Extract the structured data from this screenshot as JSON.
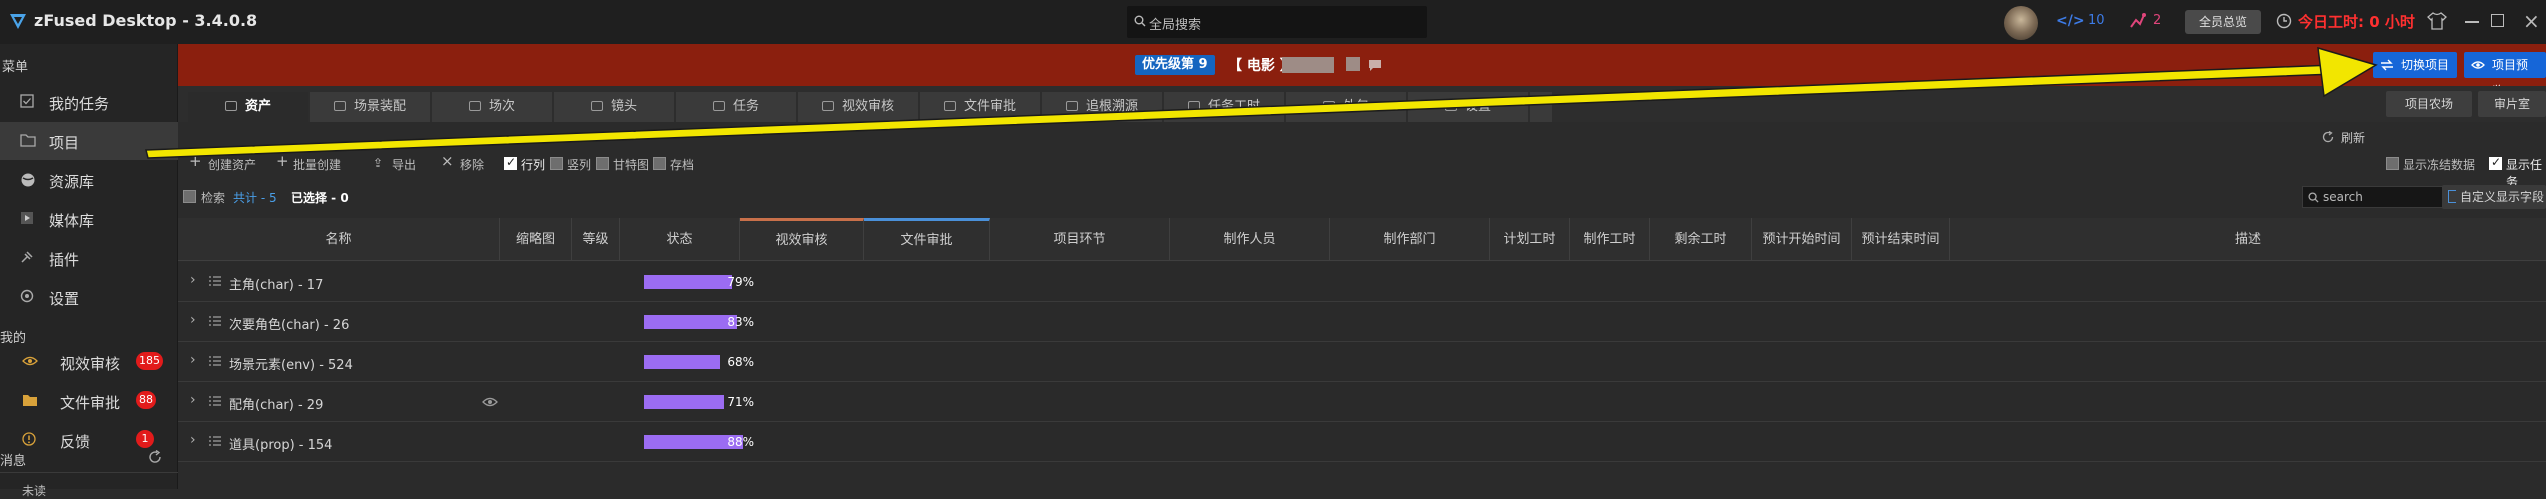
{
  "titlebar": {
    "app_title": "zFused Desktop - 3.4.0.8",
    "search_placeholder": "全局搜索",
    "code_count": "10",
    "task_count": "2",
    "all_overview": "全员总览",
    "today_hours": "今日工时: 0 小时",
    "colors": {
      "code": "#3d7be6",
      "task": "#e0457b",
      "alert": "#ff3030"
    }
  },
  "sidebar": {
    "menu_label": "菜单",
    "items": [
      {
        "label": "我的任务",
        "icon": "checkbox-icon"
      },
      {
        "label": "项目",
        "icon": "folder-icon"
      },
      {
        "label": "资源库",
        "icon": "globe-icon"
      },
      {
        "label": "媒体库",
        "icon": "media-icon"
      },
      {
        "label": "插件",
        "icon": "plugin-icon"
      },
      {
        "label": "设置",
        "icon": "gear-icon"
      }
    ],
    "mine_label": "我的",
    "mine_items": [
      {
        "label": "视效审核",
        "badge": "185",
        "icon": "eye-icon"
      },
      {
        "label": "文件审批",
        "badge": "88",
        "icon": "folder-icon"
      },
      {
        "label": "反馈",
        "badge": "1",
        "icon": "alert-icon"
      }
    ],
    "messages_label": "消息",
    "last_item_label": "未读"
  },
  "banner": {
    "priority": "优先级第 9",
    "project_type": "【 电影 】",
    "switch_project": "切换项目",
    "project_preview": "项目预览",
    "background": "#8b1f0e"
  },
  "tabs": [
    {
      "label": "资产",
      "active": true
    },
    {
      "label": "场景装配"
    },
    {
      "label": "场次"
    },
    {
      "label": "镜头"
    },
    {
      "label": "任务"
    },
    {
      "label": "视效审核"
    },
    {
      "label": "文件审批"
    },
    {
      "label": "追根溯源"
    },
    {
      "label": "任务工时"
    },
    {
      "label": "外包"
    },
    {
      "label": "设置"
    }
  ],
  "right_buttons": {
    "farm": "项目农场",
    "screening": "审片室",
    "refresh": "刷新"
  },
  "toolbar": {
    "create_asset": "创建资产",
    "batch_create": "批量创建",
    "export": "导出",
    "remove": "移除",
    "view_list": "行列",
    "view_vertical": "竖列",
    "view_gantt": "甘特图",
    "archive": "存档",
    "show_frozen": "显示冻结数据",
    "show_tasks": "显示任务"
  },
  "filter": {
    "search_label": "检索",
    "total_label": "共计 - 5",
    "selected_label": "已选择 - 0",
    "search_placeholder": "search",
    "custom_fields": "自定义显示字段"
  },
  "table": {
    "headers": [
      "名称",
      "缩略图",
      "等级",
      "状态",
      "视效审核",
      "文件审批",
      "项目环节",
      "制作人员",
      "制作部门",
      "计划工时",
      "制作工时",
      "剩余工时",
      "预计开始时间",
      "预计结束时间",
      "描述"
    ],
    "rows": [
      {
        "name": "主角(char) - 17",
        "progress": 79,
        "progress_label": "79%"
      },
      {
        "name": "次要角色(char) - 26",
        "progress": 83,
        "progress_label": "83%"
      },
      {
        "name": "场景元素(env) - 524",
        "progress": 68,
        "progress_label": "68%"
      },
      {
        "name": "配角(char) - 29",
        "progress": 71,
        "progress_label": "71%",
        "has_eye": true
      },
      {
        "name": "道具(prop) - 154",
        "progress": 88,
        "progress_label": "88%"
      }
    ],
    "progress_color": "#9b6cf2",
    "vfx_review_accent": "#c8704a",
    "file_approval_accent": "#4a90d9"
  },
  "annotation": {
    "arrow_color": "#f2e600"
  }
}
